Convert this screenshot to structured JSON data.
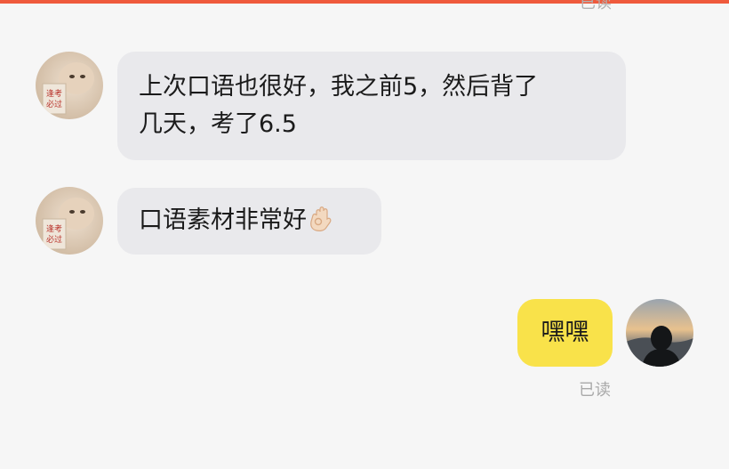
{
  "colors": {
    "accent": "#ef5a3c",
    "background": "#f6f6f6",
    "bubble_incoming": "#e9e9ec",
    "bubble_outgoing": "#f9e24a",
    "read_receipt": "#aaaaaa"
  },
  "top_read_receipt": "已读",
  "messages": [
    {
      "sender": "other",
      "avatar_icon": "cat-with-sign-avatar",
      "lines": [
        "上次口语也很好，我之前5，然后背了",
        "几天，考了6.5"
      ]
    },
    {
      "sender": "other",
      "avatar_icon": "cat-with-sign-avatar",
      "text": "口语素材非常好",
      "emoji": "ok-hand-emoji"
    },
    {
      "sender": "self",
      "avatar_icon": "sunset-silhouette-avatar",
      "text": "嘿嘿",
      "read_receipt": "已读"
    }
  ]
}
